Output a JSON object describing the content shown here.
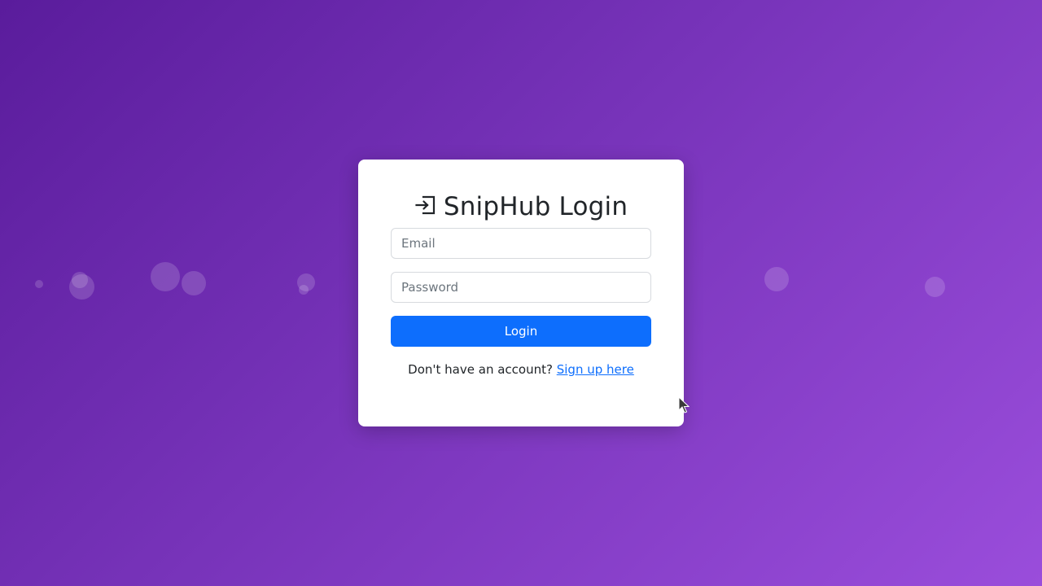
{
  "login": {
    "title": "SnipHub Login",
    "title_icon": "box-arrow-in-right-icon",
    "email_placeholder": "Email",
    "email_value": "",
    "password_placeholder": "Password",
    "password_value": "",
    "submit_label": "Login",
    "signup_prompt": "Don't have an account?",
    "signup_link": "Sign up here"
  },
  "colors": {
    "background_start": "#5a1c9c",
    "background_end": "#9a4ddb",
    "primary": "#0d6efd",
    "card": "#ffffff"
  }
}
